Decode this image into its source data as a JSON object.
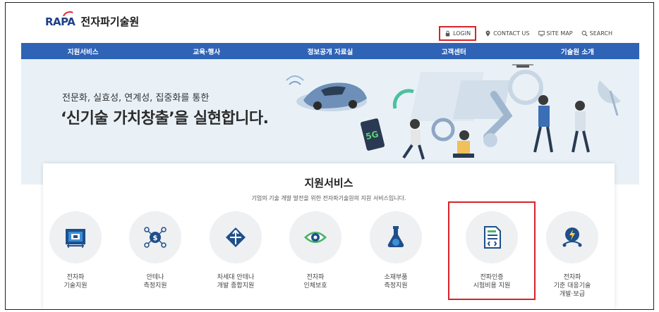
{
  "header": {
    "logo_mark": "RAPA",
    "logo_name": "전자파기술원",
    "util": {
      "login": "LOGIN",
      "contact": "CONTACT US",
      "sitemap": "SITE MAP",
      "search": "SEARCH"
    }
  },
  "nav": {
    "items": [
      {
        "label": "지원서비스"
      },
      {
        "label": "교육·행사"
      },
      {
        "label": "정보공개 자료실"
      },
      {
        "label": "고객센터"
      },
      {
        "label": "기술원 소개"
      }
    ]
  },
  "hero": {
    "subtitle": "전문화, 실효성, 연계성, 집중화를 통한",
    "title": "‘신기술 가치창출’을 실현합니다."
  },
  "services": {
    "title": "지원서비스",
    "subtitle": "기업의 기술 개발 발전을 위한 전자파기술원의 지원 서비스입니다.",
    "items": [
      {
        "label": "전자파\n기술지원",
        "icon": "circuit-board-icon"
      },
      {
        "label": "안테나\n측정지원",
        "icon": "antenna-network-icon"
      },
      {
        "label": "차세대 안테나\n개발 종합지원",
        "icon": "direction-arrows-icon"
      },
      {
        "label": "전자파\n인체보호",
        "icon": "eye-icon"
      },
      {
        "label": "소재부품\n측정지원",
        "icon": "flask-icon"
      },
      {
        "label": "전파인증\n시험비용 지원",
        "icon": "document-certificate-icon"
      },
      {
        "label": "전자파\n기준 대응기술\n개발·보급",
        "icon": "lightning-globe-icon"
      }
    ]
  },
  "colors": {
    "nav_bg": "#2f63b6",
    "highlight": "#d8232a",
    "hero_bg": "#e9f1f7"
  }
}
